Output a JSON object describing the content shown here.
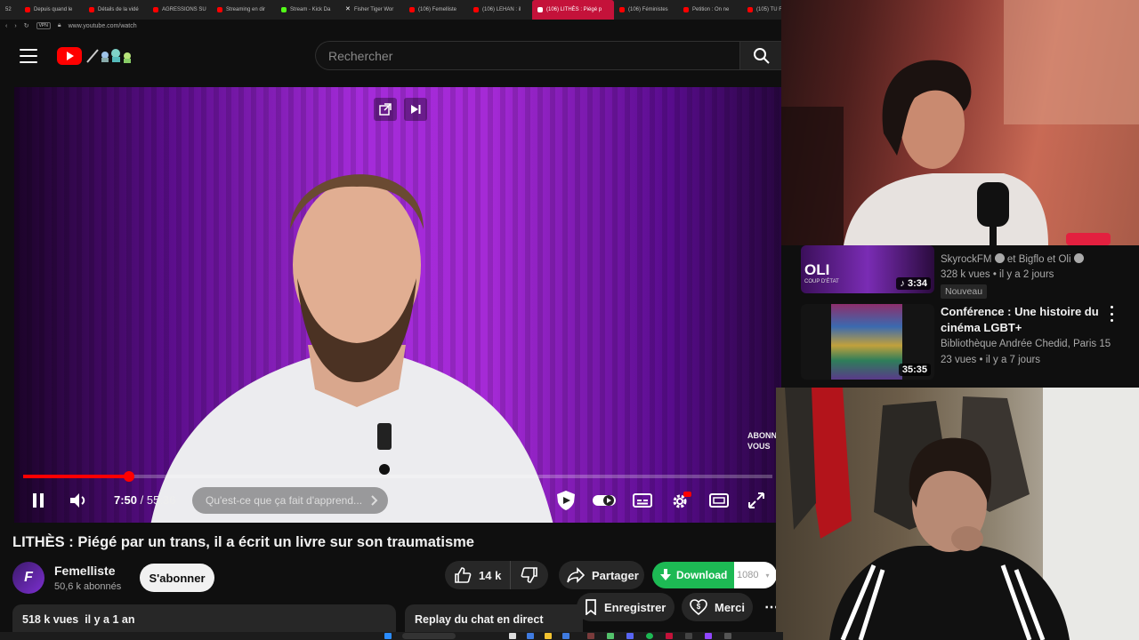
{
  "browser": {
    "tabs": [
      {
        "label": "52"
      },
      {
        "label": "Depuis quand le"
      },
      {
        "label": "Détails de la vidé"
      },
      {
        "label": "AGRESSIONS SU"
      },
      {
        "label": "Streaming en dir"
      },
      {
        "label": "Stream - Kick Da"
      },
      {
        "label": "Fisher Tiger Wor"
      },
      {
        "label": "(106) Femelliste"
      },
      {
        "label": "(106) LEHAN : il"
      },
      {
        "label": "(106) LITHÈS : Piégé p"
      },
      {
        "label": "(106) Féministes"
      },
      {
        "label": "Petition : On ne"
      },
      {
        "label": "(105) TU F"
      }
    ],
    "vpn_badge": "VPN",
    "url": "www.youtube.com/watch"
  },
  "header": {
    "search_placeholder": "Rechercher"
  },
  "player": {
    "current_time": "7:50",
    "time_separator": "/",
    "duration": "55:36",
    "progress_fraction": 0.141,
    "chapter_label": "Qu'est-ce que ça fait d'apprend...",
    "watermark_line1": "ABONNE",
    "watermark_line2": "VOUS"
  },
  "video": {
    "title": "LITHÈS : Piégé par un trans, il a écrit un livre sur son traumatisme",
    "channel_name": "Femelliste",
    "channel_initial": "F",
    "subscribers": "50,6 k abonnés",
    "subscribe_label": "S'abonner",
    "likes": "14 k",
    "share_label": "Partager",
    "download_label": "Download",
    "quality": "1080",
    "save_label": "Enregistrer",
    "thanks_label": "Merci",
    "views_date": "518 k vues  il y a 1 an",
    "chat_replay_label": "Replay du chat en direct"
  },
  "suggestions": [
    {
      "thumb_text_line1": "OLI",
      "thumb_text_line2": "COUP D'ÉTAT",
      "duration": "3:34",
      "channel": "SkyrockFM",
      "channel_suffix": "et Bigflo et Oli",
      "meta": "328 k vues • il y a 2 jours",
      "badge": "Nouveau"
    },
    {
      "title": "Conférence : Une histoire du cinéma LGBT+",
      "duration": "35:35",
      "channel": "Bibliothèque Andrée Chedid, Paris 15",
      "meta": "23 vues • il y a 7 jours"
    }
  ],
  "colors": {
    "accent": "#ff0000",
    "download": "#1db954",
    "background": "#0f0f0f",
    "pill": "#272727"
  }
}
